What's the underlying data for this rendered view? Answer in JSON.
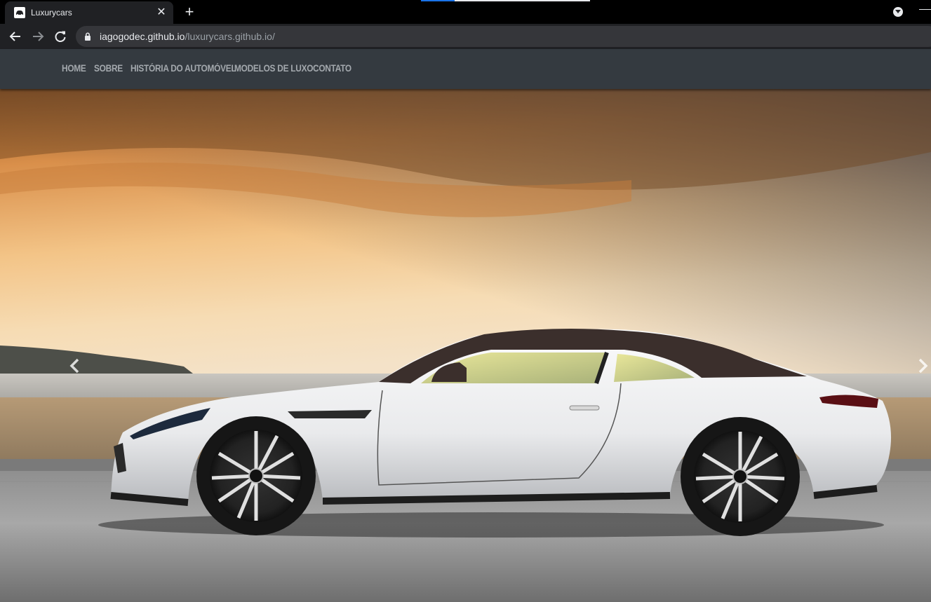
{
  "browser": {
    "tab": {
      "title": "Luxurycars",
      "favicon": "car-icon"
    },
    "url": {
      "host": "iagogodec.github.io",
      "path": "/luxurycars.github.io/"
    }
  },
  "nav": {
    "items": [
      {
        "label": "HOME"
      },
      {
        "label": "SOBRE"
      },
      {
        "label": "HISTÓRIA DO AUTOMÓVEL"
      },
      {
        "label": "MODELOS DE LUXO"
      },
      {
        "label": "CONTATO"
      }
    ]
  },
  "carousel": {
    "prev_icon": "chevron-left-icon",
    "next_icon": "chevron-right-icon"
  }
}
